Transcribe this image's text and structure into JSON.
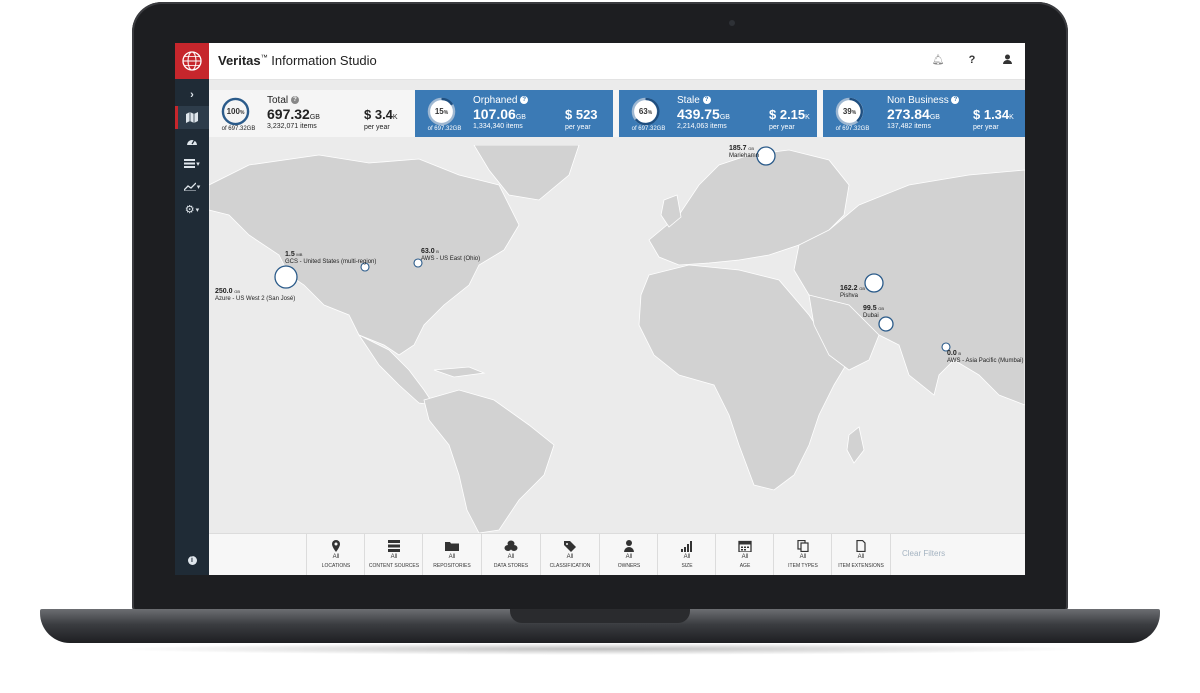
{
  "app": {
    "brand_bold": "Veritas",
    "brand_tm": "™",
    "brand_rest": " Information Studio"
  },
  "header_icons": [
    "bell-icon",
    "help-icon",
    "user-icon"
  ],
  "help_glyph": "?",
  "sidebar": {
    "items": [
      {
        "name": "expand",
        "icon": "chevron-right-icon"
      },
      {
        "name": "map",
        "icon": "map-icon",
        "active": true
      },
      {
        "name": "dashboard",
        "icon": "dashboard-icon"
      },
      {
        "name": "list",
        "icon": "list-icon"
      },
      {
        "name": "reports",
        "icon": "line-chart-icon"
      },
      {
        "name": "settings",
        "icon": "gear-icon"
      }
    ],
    "info_icon": "info-icon"
  },
  "stats": {
    "total": {
      "percent": "100",
      "pct_sign": "%",
      "of": "of 697.32GB",
      "label": "Total",
      "gb": "697.32",
      "gb_unit": "GB",
      "items": "3,232,071 items",
      "cost": "$ 3.4",
      "cost_unit": "K",
      "per_year": "per year"
    },
    "orphaned": {
      "percent": "15",
      "pct_sign": "%",
      "of": "of 697.32GB",
      "label": "Orphaned",
      "gb": "107.06",
      "gb_unit": "GB",
      "items": "1,334,340 items",
      "cost": "$ 523",
      "cost_unit": "",
      "per_year": "per year"
    },
    "stale": {
      "percent": "63",
      "pct_sign": "%",
      "of": "of 697.32GB",
      "label": "Stale",
      "gb": "439.75",
      "gb_unit": "GB",
      "items": "2,214,063 items",
      "cost": "$ 2.15",
      "cost_unit": "K",
      "per_year": "per year"
    },
    "nonbusiness": {
      "percent": "39",
      "pct_sign": "%",
      "of": "of 697.32GB",
      "label": "Non Business",
      "gb": "273.84",
      "gb_unit": "GB",
      "items": "137,482 items",
      "cost": "$ 1.34",
      "cost_unit": "K",
      "per_year": "per year"
    }
  },
  "map_locations": [
    {
      "size": "185.7",
      "unit": "GB",
      "name": "Mariehamn"
    },
    {
      "size": "1.5",
      "unit": "MB",
      "name": "GCS - United States (multi-region)"
    },
    {
      "size": "63.0",
      "unit": "B",
      "name": "AWS - US East (Ohio)"
    },
    {
      "size": "250.0",
      "unit": "GB",
      "name": "Azure - US West 2 (San José)"
    },
    {
      "size": "162.2",
      "unit": "GB",
      "name": "Pishva"
    },
    {
      "size": "99.5",
      "unit": "GB",
      "name": "Dubai"
    },
    {
      "size": "0.0",
      "unit": "B",
      "name": "AWS - Asia Pacific (Mumbai)"
    }
  ],
  "filters": [
    {
      "label": "Locations",
      "value": "All",
      "icon": "pin-icon"
    },
    {
      "label": "Content Sources",
      "value": "All",
      "icon": "server-icon"
    },
    {
      "label": "Repositories",
      "value": "All",
      "icon": "folder-icon"
    },
    {
      "label": "Data Stores",
      "value": "All",
      "icon": "database-icon"
    },
    {
      "label": "Classification",
      "value": "All",
      "icon": "tag-icon"
    },
    {
      "label": "Owners",
      "value": "All",
      "icon": "person-icon"
    },
    {
      "label": "Size",
      "value": "All",
      "icon": "bars-icon"
    },
    {
      "label": "Age",
      "value": "All",
      "icon": "calendar-icon"
    },
    {
      "label": "Item Types",
      "value": "All",
      "icon": "files-icon"
    },
    {
      "label": "Item Extensions",
      "value": "All",
      "icon": "file-icon"
    }
  ],
  "clear_filters": "Clear Filters",
  "colors": {
    "brand_red": "#c6262c",
    "sidebar": "#1f2b36",
    "stat_blue": "#3b7ab5",
    "land": "#d2d2d2",
    "ocean": "#ebebeb"
  }
}
